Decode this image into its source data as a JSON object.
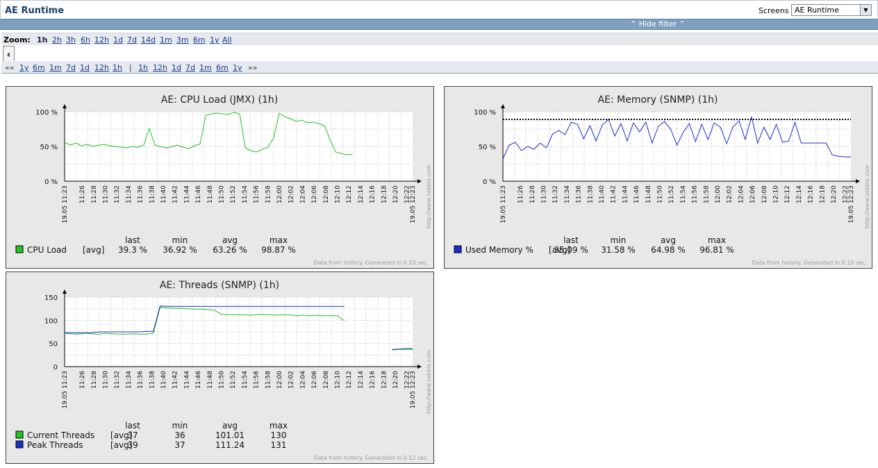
{
  "header": {
    "title": "AE Runtime",
    "screens_label": "Screens",
    "screens_selected": "AE Runtime"
  },
  "filter": {
    "hide_label": "⌃ Hide filter ⌃"
  },
  "zoom": {
    "label": "Zoom:",
    "options": [
      "1h",
      "2h",
      "3h",
      "6h",
      "12h",
      "1d",
      "7d",
      "14d",
      "1m",
      "3m",
      "6m",
      "1y",
      "All"
    ],
    "active": "1h"
  },
  "period": {
    "prev_all": "««",
    "back": [
      "1y",
      "6m",
      "1m",
      "7d",
      "1d",
      "12h",
      "1h"
    ],
    "separator": "|",
    "forward": [
      "1h",
      "12h",
      "1d",
      "7d",
      "1m",
      "6m",
      "1y"
    ],
    "next_all": "»»",
    "scroll_icon": "chevron-left-icon"
  },
  "time_axis": {
    "start": "19.05 11:23",
    "end": "19.05 12:23",
    "ticks": [
      "11:26",
      "11:28",
      "11:30",
      "11:32",
      "11:34",
      "11:36",
      "11:38",
      "11:40",
      "11:42",
      "11:44",
      "11:46",
      "11:48",
      "11:50",
      "11:52",
      "11:54",
      "11:56",
      "11:58",
      "12:00",
      "12:02",
      "12:04",
      "12:06",
      "12:08",
      "12:10",
      "12:12",
      "12:14",
      "12:16",
      "12:18",
      "12:20",
      "12:22"
    ],
    "watermark": "http://www.zabbix.com"
  },
  "graphs": [
    {
      "title": "AE: CPU Load (JMX) (1h)",
      "yticks": [
        "0 %",
        "50 %",
        "100 %"
      ],
      "headers": [
        "last",
        "min",
        "avg",
        "max"
      ],
      "items": [
        {
          "name": "CPU Load",
          "func": "[avg]",
          "last": "39.3 %",
          "min": "36.92 %",
          "avg": "63.26 %",
          "max": "98.87 %",
          "color": "#22c222"
        }
      ],
      "footer": "Data from history. Generated in 0.10 sec."
    },
    {
      "title": "AE: Memory (SNMP) (1h)",
      "yticks": [
        "0 %",
        "50 %",
        "100 %"
      ],
      "headers": [
        "last",
        "min",
        "avg",
        "max"
      ],
      "items": [
        {
          "name": "Used Memory %",
          "func": "[avg]",
          "last": "35.09 %",
          "min": "31.58 %",
          "avg": "64.98 %",
          "max": "96.81 %",
          "color": "#1c2cc8"
        }
      ],
      "footer": "Data from history. Generated in 0.10 sec."
    },
    {
      "title": "AE: Threads (SNMP) (1h)",
      "yticks": [
        "0",
        "50",
        "100",
        "150"
      ],
      "headers": [
        "last",
        "min",
        "avg",
        "max"
      ],
      "items": [
        {
          "name": "Current Threads",
          "func": "[avg]",
          "last": "37",
          "min": "36",
          "avg": "101.01",
          "max": "130",
          "color": "#22c222"
        },
        {
          "name": "Peak Threads",
          "func": "[avg]",
          "last": "39",
          "min": "37",
          "avg": "111.24",
          "max": "131",
          "color": "#1c2cc8"
        }
      ],
      "footer": "Data from history. Generated in 0.12 sec."
    }
  ],
  "chart_data": [
    {
      "type": "line",
      "title": "AE: CPU Load (JMX) (1h)",
      "ylim": [
        0,
        100
      ],
      "x_minutes_from_start": [
        0,
        1,
        2,
        3,
        4,
        5,
        6,
        7,
        8,
        9,
        10,
        11,
        12,
        13,
        14,
        15,
        16,
        17,
        18,
        19,
        20,
        21,
        22,
        23,
        24,
        25,
        26,
        27,
        28,
        29,
        30,
        31,
        32,
        33,
        34,
        35,
        36,
        37,
        38,
        39,
        40,
        41,
        42,
        43,
        44,
        45,
        46,
        47,
        48,
        49,
        50,
        51,
        52,
        53
      ],
      "series": [
        {
          "name": "CPU Load",
          "color": "#22c222",
          "values": [
            56,
            52,
            55,
            51,
            53,
            50,
            52,
            53,
            51,
            50,
            49,
            48,
            50,
            49,
            52,
            76,
            52,
            50,
            48,
            50,
            52,
            49,
            47,
            51,
            54,
            95,
            97,
            98,
            97,
            96,
            99,
            97,
            48,
            44,
            42,
            46,
            49,
            62,
            98,
            93,
            90,
            86,
            88,
            84,
            85,
            83,
            80,
            60,
            42,
            40,
            38,
            39,
            null,
            null
          ]
        }
      ]
    },
    {
      "type": "line",
      "title": "AE: Memory (SNMP) (1h)",
      "ylim": [
        0,
        100
      ],
      "threshold": 89,
      "series": [
        {
          "name": "Used Memory %",
          "color": "#1c2cc8",
          "values": [
            32,
            52,
            56,
            44,
            50,
            46,
            55,
            48,
            68,
            73,
            67,
            85,
            82,
            61,
            80,
            58,
            81,
            89,
            65,
            83,
            58,
            84,
            71,
            85,
            55,
            79,
            86,
            75,
            52,
            70,
            83,
            57,
            82,
            60,
            84,
            78,
            54,
            78,
            87,
            60,
            93,
            55,
            78,
            60,
            82,
            56,
            58,
            85,
            55,
            55,
            55,
            55,
            55,
            38,
            36,
            35,
            35
          ]
        }
      ]
    },
    {
      "type": "line",
      "title": "AE: Threads (SNMP) (1h)",
      "ylim": [
        0,
        150
      ],
      "series": [
        {
          "name": "Current Threads",
          "color": "#22c222",
          "values": [
            72,
            71,
            70,
            72,
            71,
            70,
            72,
            71,
            70,
            70,
            71,
            70,
            70,
            72,
            128,
            127,
            126,
            126,
            125,
            124,
            124,
            123,
            122,
            113,
            112,
            112,
            112,
            111,
            112,
            113,
            112,
            111,
            112,
            112,
            110,
            111,
            110,
            111,
            110,
            110,
            110,
            99,
            null,
            null,
            null,
            null,
            null,
            null,
            36,
            37,
            37,
            37
          ]
        },
        {
          "name": "Peak Threads",
          "color": "#1c2cc8",
          "values": [
            73,
            73,
            73,
            73,
            73,
            75,
            75,
            75,
            75,
            75,
            75,
            75,
            76,
            76,
            131,
            130,
            130,
            130,
            130,
            130,
            130,
            130,
            130,
            130,
            130,
            130,
            130,
            130,
            130,
            130,
            130,
            130,
            130,
            130,
            130,
            130,
            130,
            130,
            130,
            130,
            130,
            130,
            null,
            null,
            null,
            null,
            null,
            null,
            37,
            38,
            39,
            39
          ]
        }
      ]
    }
  ]
}
